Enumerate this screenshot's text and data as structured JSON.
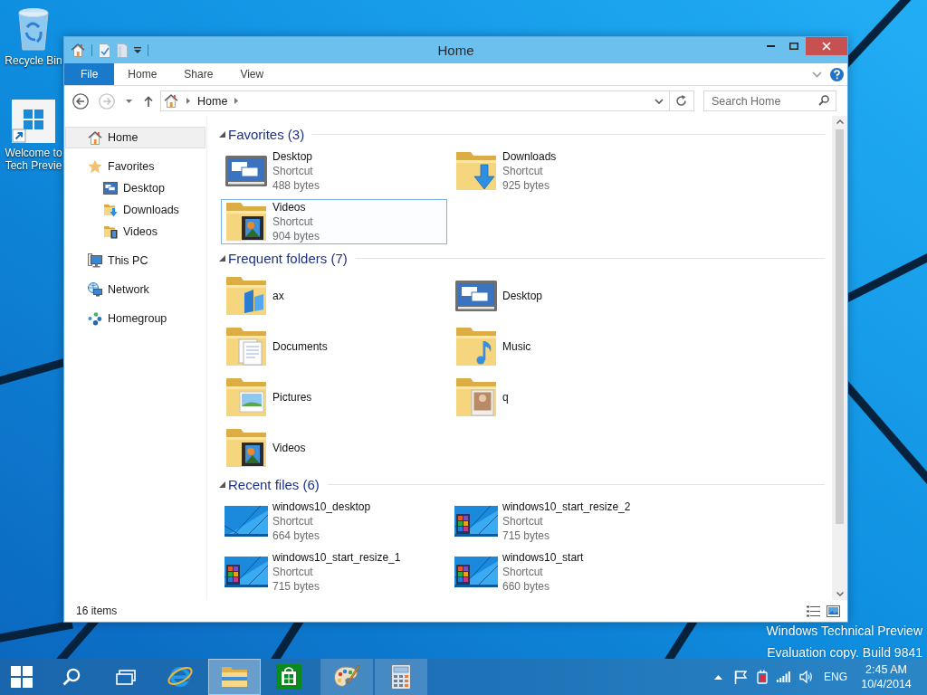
{
  "desktop": {
    "icons": [
      {
        "kind": "recycle-bin",
        "label": "Recycle Bin"
      },
      {
        "kind": "shortcut",
        "label": "Welcome to Tech Previe"
      }
    ],
    "watermark": [
      "Windows Technical Preview",
      "Evaluation copy. Build 9841"
    ]
  },
  "window": {
    "title": "Home",
    "ribbon_tabs": [
      {
        "label": "File",
        "kind": "file"
      },
      {
        "label": "Home",
        "kind": "tab"
      },
      {
        "label": "Share",
        "kind": "tab"
      },
      {
        "label": "View",
        "kind": "tab"
      }
    ],
    "nav_buttons": [
      {
        "kind": "back",
        "disabled": false
      },
      {
        "kind": "forward",
        "disabled": true
      }
    ],
    "address": {
      "crumbs": [
        "Home"
      ]
    },
    "search": {
      "placeholder": "Search Home"
    },
    "sidebar": {
      "items": [
        {
          "label": "Home",
          "kind": "home",
          "selected": true
        },
        {
          "label": "Favorites",
          "kind": "favorites",
          "selected": false,
          "children": [
            {
              "label": "Desktop",
              "kind": "desktop",
              "selected": false
            },
            {
              "label": "Downloads",
              "kind": "downloads",
              "selected": false
            },
            {
              "label": "Videos",
              "kind": "videos",
              "selected": false
            }
          ]
        },
        {
          "label": "This PC",
          "kind": "computer",
          "selected": false
        },
        {
          "label": "Network",
          "kind": "network",
          "selected": false
        },
        {
          "label": "Homegroup",
          "kind": "homegroup",
          "selected": false
        }
      ]
    },
    "content": {
      "groups": [
        {
          "title": "Favorites (3)",
          "expanded": true,
          "items": [
            {
              "name": "Desktop",
              "kind": "desktop",
              "type": "Shortcut",
              "size": "488 bytes",
              "selected": false
            },
            {
              "name": "Downloads",
              "kind": "downloads",
              "type": "Shortcut",
              "size": "925 bytes",
              "selected": false
            },
            {
              "name": "Videos",
              "kind": "videos",
              "type": "Shortcut",
              "size": "904 bytes",
              "selected": true
            }
          ]
        },
        {
          "title": "Frequent folders (7)",
          "expanded": true,
          "items": [
            {
              "name": "ax",
              "kind": "folder",
              "selected": false
            },
            {
              "name": "Desktop",
              "kind": "desktop",
              "selected": false
            },
            {
              "name": "Documents",
              "kind": "documents",
              "selected": false
            },
            {
              "name": "Music",
              "kind": "music",
              "selected": false
            },
            {
              "name": "Pictures",
              "kind": "pictures",
              "selected": false
            },
            {
              "name": "q",
              "kind": "photo",
              "selected": false
            },
            {
              "name": "Videos",
              "kind": "videos",
              "selected": false
            }
          ]
        },
        {
          "title": "Recent files (6)",
          "expanded": true,
          "items": [
            {
              "name": "windows10_desktop",
              "kind": "screenshot",
              "type": "Shortcut",
              "size": "664 bytes",
              "selected": false
            },
            {
              "name": "windows10_start_resize_2",
              "kind": "startscreen",
              "type": "Shortcut",
              "size": "715 bytes",
              "selected": false
            },
            {
              "name": "windows10_start_resize_1",
              "kind": "startscreen",
              "type": "Shortcut",
              "size": "715 bytes",
              "selected": false
            },
            {
              "name": "windows10_start",
              "kind": "startscreen",
              "type": "Shortcut",
              "size": "660 bytes",
              "selected": false
            }
          ]
        }
      ]
    },
    "status_bar": {
      "item_count": "16 items"
    }
  },
  "taskbar": {
    "apps": [
      {
        "kind": "browser",
        "open": false,
        "selected": false
      },
      {
        "kind": "explorer",
        "open": true,
        "selected": true
      },
      {
        "kind": "store",
        "open": false,
        "selected": false
      },
      {
        "kind": "paint",
        "open": true,
        "selected": false
      },
      {
        "kind": "calculator",
        "open": true,
        "selected": false
      }
    ],
    "tray": {
      "language": "ENG",
      "time": "2:45 AM",
      "date": "10/4/2014"
    }
  }
}
